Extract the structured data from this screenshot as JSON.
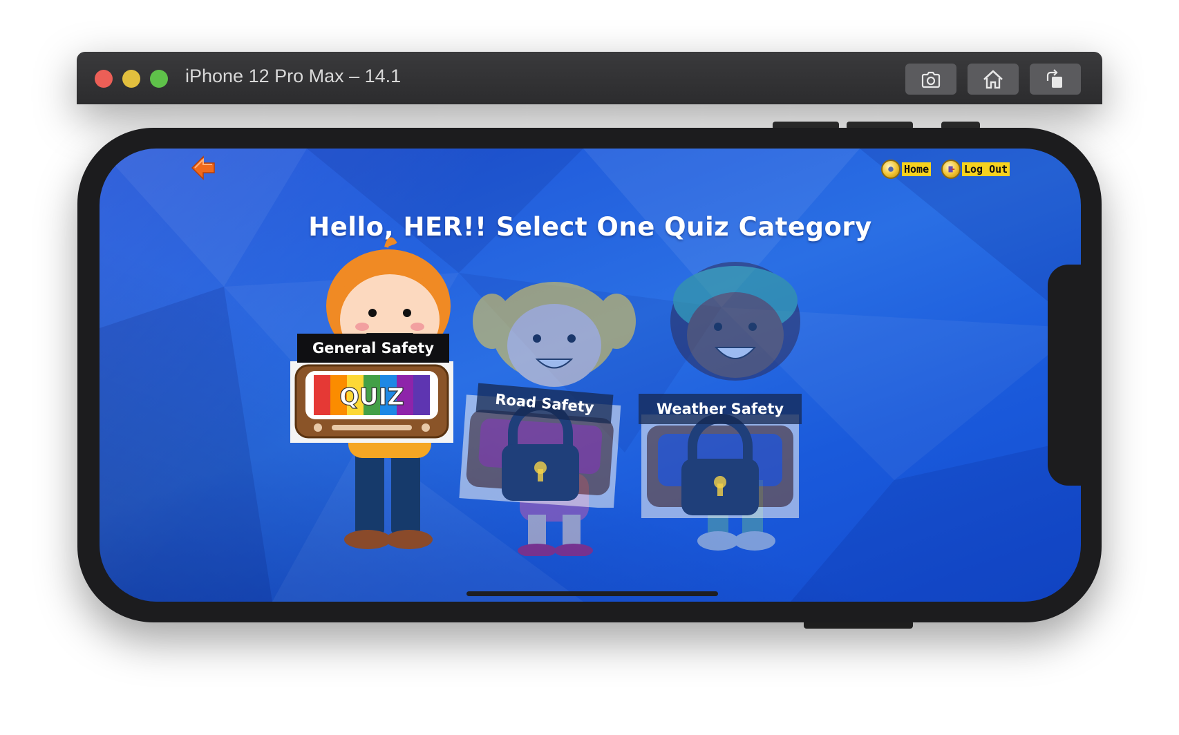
{
  "window": {
    "title": "iPhone 12 Pro Max – 14.1",
    "buttons": [
      {
        "name": "screenshot-button",
        "icon": "camera-icon"
      },
      {
        "name": "home-button",
        "icon": "home-icon"
      },
      {
        "name": "rotate-button",
        "icon": "rotate-icon"
      }
    ]
  },
  "app": {
    "back_icon": "back-arrow-icon",
    "nav": {
      "home_label": "Home",
      "logout_label": "Log Out"
    },
    "headline": "Hello, HER!! Select One Quiz Category",
    "categories": [
      {
        "label": "General Safety",
        "locked": false,
        "badge": "QUIZ"
      },
      {
        "label": "Road Safety",
        "locked": true
      },
      {
        "label": "Weather Safety",
        "locked": true
      }
    ]
  },
  "colors": {
    "background": "#1b5ad9",
    "nav_label": "#f6d21e",
    "back_arrow": "#f06a1c",
    "lock": "#1f3f7a"
  }
}
